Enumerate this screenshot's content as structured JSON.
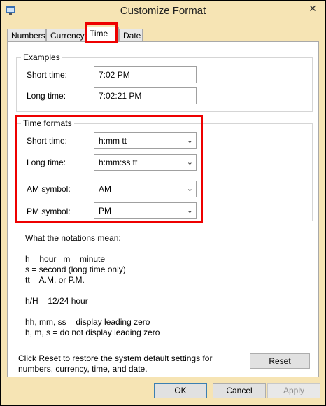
{
  "window": {
    "title": "Customize Format",
    "close_glyph": "✕"
  },
  "tabs": [
    {
      "label": "Numbers"
    },
    {
      "label": "Currency"
    },
    {
      "label": "Time"
    },
    {
      "label": "Date"
    }
  ],
  "examples": {
    "heading": "Examples",
    "short_label": "Short time:",
    "short_value": "7:02 PM",
    "long_label": "Long time:",
    "long_value": "7:02:21 PM"
  },
  "time_formats": {
    "heading": "Time formats",
    "short_label": "Short time:",
    "short_value": "h:mm tt",
    "long_label": "Long time:",
    "long_value": "h:mm:ss tt",
    "am_label": "AM symbol:",
    "am_value": "AM",
    "pm_label": "PM symbol:",
    "pm_value": "PM"
  },
  "notations": {
    "heading": "What the notations mean:",
    "lines": [
      "h = hour   m = minute",
      "s = second (long time only)",
      "tt = A.M. or P.M.",
      "h/H = 12/24 hour",
      "hh, mm, ss = display leading zero",
      "h, m, s = do not display leading zero"
    ]
  },
  "reset": {
    "text_line1": "Click Reset to restore the system default settings for",
    "text_line2": "numbers, currency, time, and date.",
    "button": "Reset"
  },
  "footer": {
    "ok": "OK",
    "cancel": "Cancel",
    "apply": "Apply"
  },
  "colors": {
    "title_bar": "#f6e4b4",
    "highlight": "#e00000"
  }
}
